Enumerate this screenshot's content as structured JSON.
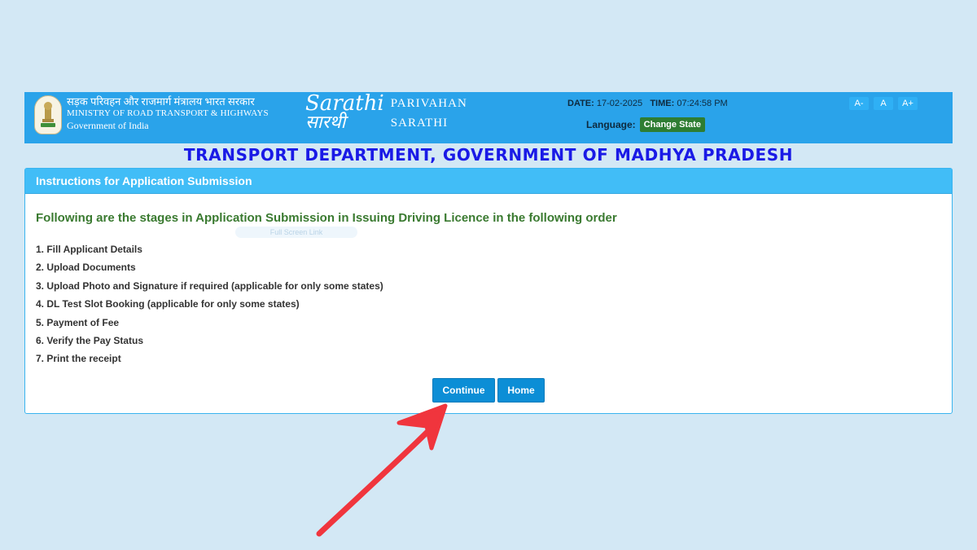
{
  "header": {
    "ministry_hindi": "सड़क परिवहन और राजमार्ग मंत्रालय भारत सरकार",
    "ministry_english": "MINISTRY OF ROAD TRANSPORT & HIGHWAYS",
    "government": "Government of India",
    "logo_en": "Sarathi",
    "logo_hi": "सारथी",
    "parivahan": "PARIVAHAN",
    "sarathi": "SARATHI",
    "date_label": "DATE:",
    "date_value": "17-02-2025",
    "time_label": "TIME:",
    "time_value": "07:24:58 PM",
    "language_label": "Language:",
    "change_state": "Change State",
    "font_decrease": "A-",
    "font_normal": "A",
    "font_increase": "A+"
  },
  "page": {
    "department_title": "TRANSPORT DEPARTMENT, GOVERNMENT OF MADHYA PRADESH"
  },
  "panel": {
    "heading": "Instructions for Application Submission",
    "stages_title": "Following are the stages in Application Submission in Issuing Driving Licence in the following order",
    "faded_link": "Full Screen Link",
    "steps": [
      "1. Fill Applicant Details",
      "2. Upload Documents",
      "3. Upload Photo and Signature if required (applicable for only some states)",
      "4. DL Test Slot Booking (applicable for only some states)",
      "5. Payment of Fee",
      "6. Verify the Pay Status",
      "7. Print the receipt"
    ],
    "continue_label": "Continue",
    "home_label": "Home"
  },
  "colors": {
    "header_bg": "#2aa3ea",
    "panel_head_bg": "#41bdf7",
    "button_bg": "#0c8ed6",
    "title_blue": "#1a1ae6",
    "stage_green": "#3a7a30",
    "arrow_red": "#f0353d"
  }
}
